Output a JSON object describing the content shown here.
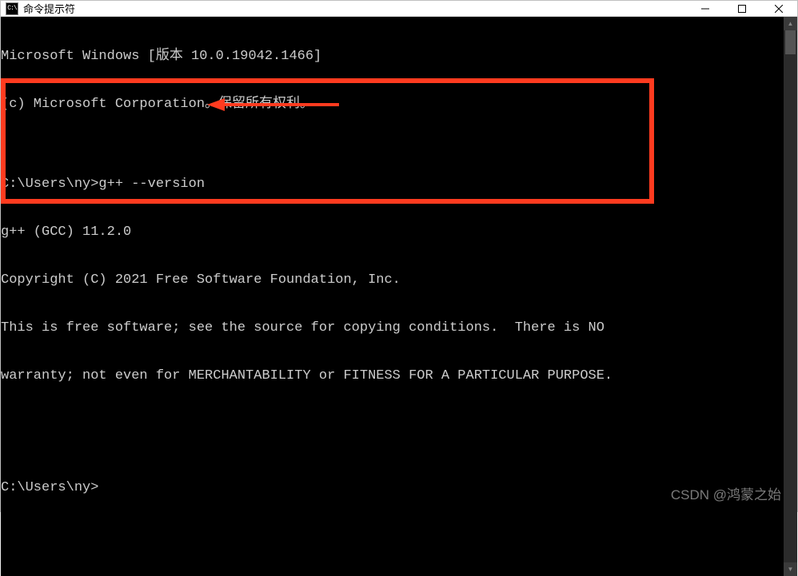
{
  "window": {
    "title": "命令提示符"
  },
  "terminal": {
    "lines": [
      "Microsoft Windows [版本 10.0.19042.1466]",
      "(c) Microsoft Corporation。保留所有权利。",
      "",
      "C:\\Users\\ny>g++ --version",
      "g++ (GCC) 11.2.0",
      "Copyright (C) 2021 Free Software Foundation, Inc.",
      "This is free software; see the source for copying conditions.  There is NO",
      "warranty; not even for MERCHANTABILITY or FITNESS FOR A PARTICULAR PURPOSE.",
      "",
      "",
      "C:\\Users\\ny>"
    ]
  },
  "watermark": "CSDN @鸿蒙之始"
}
